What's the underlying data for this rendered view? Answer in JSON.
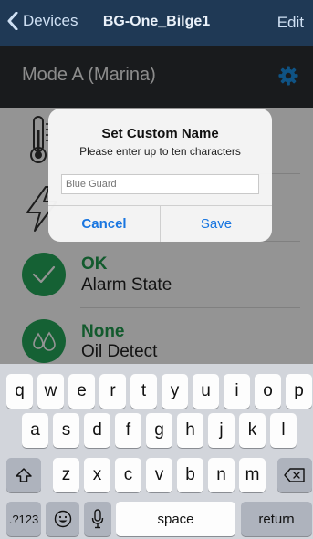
{
  "nav": {
    "back_label": "Devices",
    "title": "BG-One_Bilge1",
    "edit_label": "Edit"
  },
  "mode": {
    "title": "Mode A (Marina)"
  },
  "rows": [
    {
      "icon": "thermometer-icon"
    },
    {
      "icon": "lightning-icon"
    },
    {
      "status": "OK",
      "label": "Alarm State",
      "icon": "checkmark-icon"
    },
    {
      "status": "None",
      "label": "Oil Detect",
      "icon": "oil-drops-icon"
    }
  ],
  "alert": {
    "title": "Set Custom Name",
    "message": "Please enter up to ten characters",
    "input_placeholder": "Blue Guard",
    "cancel_label": "Cancel",
    "save_label": "Save"
  },
  "keyboard": {
    "row1": [
      "q",
      "w",
      "e",
      "r",
      "t",
      "y",
      "u",
      "i",
      "o",
      "p"
    ],
    "row2": [
      "a",
      "s",
      "d",
      "f",
      "g",
      "h",
      "j",
      "k",
      "l"
    ],
    "row3": [
      "z",
      "x",
      "c",
      "v",
      "b",
      "n",
      "m"
    ],
    "numbers_label": ".?123",
    "space_label": "space",
    "return_label": "return"
  },
  "colors": {
    "nav_bg": "#1f3955",
    "mode_bg": "#2c2f33",
    "accent_blue": "#1976e0",
    "status_green": "#25a85a"
  }
}
